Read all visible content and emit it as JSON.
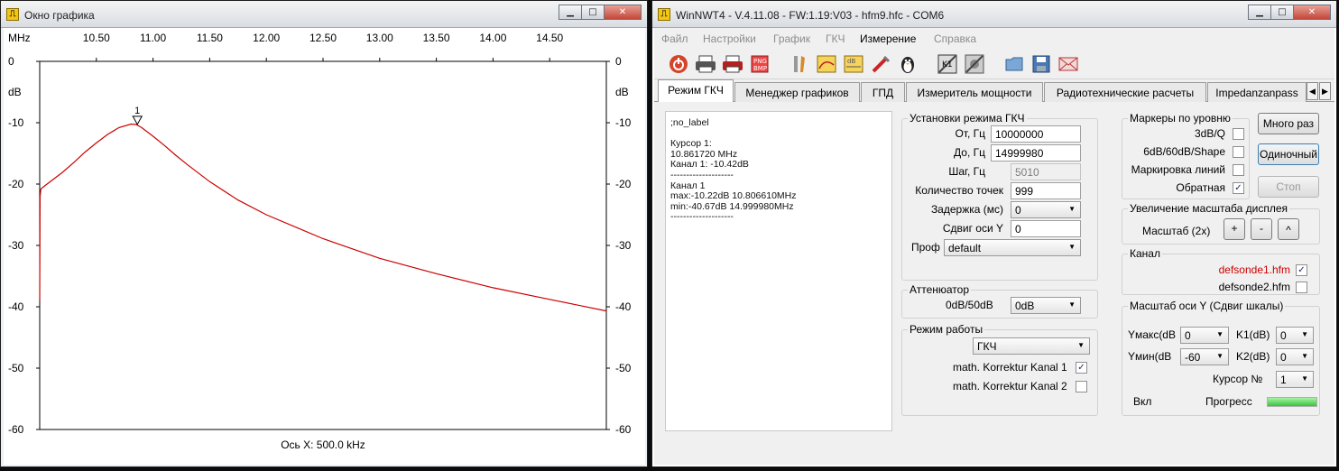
{
  "graph_window": {
    "title": "Окно графика",
    "x_axis_label": "Ось X: 500.0 kHz",
    "unit_top_left": "MHz",
    "db_label": "dB",
    "marker_label": "1"
  },
  "chart_data": {
    "type": "line",
    "xlim": [
      10.0,
      15.0
    ],
    "ylim": [
      -60,
      0
    ],
    "x_ticks": [
      "10.50",
      "11.00",
      "11.50",
      "12.00",
      "12.50",
      "13.00",
      "13.50",
      "14.00",
      "14.50"
    ],
    "y_ticks": [
      "0",
      "-10",
      "-20",
      "-30",
      "-40",
      "-50",
      "-60"
    ],
    "grid": false,
    "series": [
      {
        "color": "#cc0000",
        "x": [
          10.0,
          10.003,
          10.01,
          10.05,
          10.1,
          10.2,
          10.3,
          10.4,
          10.5,
          10.6,
          10.7,
          10.8066,
          10.85,
          10.9,
          11.0,
          11.1,
          11.2,
          11.3,
          11.5,
          11.75,
          12.0,
          12.5,
          13.0,
          13.5,
          14.0,
          14.5,
          15.0
        ],
        "y": [
          -39.0,
          -22.0,
          -20.8,
          -20.2,
          -19.5,
          -18.1,
          -16.5,
          -14.8,
          -13.3,
          -11.9,
          -10.8,
          -10.22,
          -10.3,
          -10.8,
          -12.2,
          -13.7,
          -15.3,
          -16.8,
          -19.6,
          -22.6,
          -25.0,
          -28.9,
          -32.1,
          -34.6,
          -36.9,
          -38.8,
          -40.67
        ]
      }
    ],
    "marker": {
      "x": 10.8617,
      "y": -10.42,
      "label": "1"
    }
  },
  "main_window": {
    "title": "WinNWT4 - V.4.11.08 - FW:1.19:V03 - hfm9.hfc - COM6",
    "menu": [
      "Файл",
      "Настройки",
      "График",
      "ГКЧ",
      "Измерение",
      "Справка"
    ],
    "toolbar_icons": [
      "power-icon",
      "printer-icon",
      "printer-color-icon",
      "png-export-icon",
      "tools-icon",
      "chart-icon",
      "db-icon",
      "probe-icon",
      "linux-icon",
      "k1-icon",
      "settings-icon",
      "open-icon",
      "save-icon",
      "envelope-icon"
    ],
    "tabs": [
      "Режим ГКЧ",
      "Менеджер графиков",
      "ГПД",
      "Измеритель мощности",
      "Радиотехнические расчеты",
      "Impedanzanpass"
    ],
    "info_lines": [
      ";no_label",
      "",
      "Курсор 1:",
      "10.861720 MHz",
      "Канал 1:  -10.42dB",
      "--------------------",
      "Канал 1",
      "max:-10.22dB 10.806610MHz",
      "min:-40.67dB 14.999980MHz",
      "--------------------"
    ],
    "sweep": {
      "title": "Установки режима ГКЧ",
      "from_label": "От, Гц",
      "from_value": "10000000",
      "to_label": "До, Гц",
      "to_value": "14999980",
      "step_label": "Шаг, Гц",
      "step_value": "5010",
      "points_label": "Количество точек",
      "points_value": "999",
      "delay_label": "Задержка (мс)",
      "delay_value": "0",
      "yshift_label": "Сдвиг оси Y",
      "yshift_value": "0",
      "profile_label": "Проф",
      "profile_value": "default"
    },
    "attenuator": {
      "title": "Аттенюатор",
      "label": "0dB/50dB",
      "value": "0dB"
    },
    "mode": {
      "title": "Режим работы",
      "value": "ГКЧ",
      "corr1_label": "math. Korrektur Kanal 1",
      "corr1_checked": true,
      "corr2_label": "math. Korrektur Kanal 2",
      "corr2_checked": false
    },
    "markers": {
      "title": "Маркеры по уровню",
      "m1": "3dB/Q",
      "m2": "6dB/60dB/Shape",
      "m3": "Маркировка линий",
      "m4": "Обратная",
      "m4_checked": true
    },
    "buttons": {
      "many": "Много раз",
      "single": "Одиночный",
      "stop": "Стоп"
    },
    "zoom": {
      "title": "Увеличение масштаба дисплея",
      "label": "Масштаб (2x)",
      "plus": "+",
      "minus": "-",
      "up": "^"
    },
    "channel": {
      "title": "Канал",
      "ch1": "defsonde1.hfm",
      "ch1_checked": true,
      "ch1_color": "#cc0000",
      "ch2": "defsonde2.hfm",
      "ch2_checked": false
    },
    "yscale": {
      "title": "Масштаб оси Y (Сдвиг шкалы)",
      "ymax_label": "Yмакс(dB",
      "ymax_value": "0",
      "ymin_label": "Yмин(dB",
      "ymin_value": "-60",
      "k1_label": "K1(dB)",
      "k1_value": "0",
      "k2_label": "K2(dB)",
      "k2_value": "0",
      "cursor_label": "Курсор №",
      "cursor_value": "1",
      "on_label": "Вкл",
      "progress_label": "Прогресс",
      "progress_fraction": 1.0
    }
  }
}
